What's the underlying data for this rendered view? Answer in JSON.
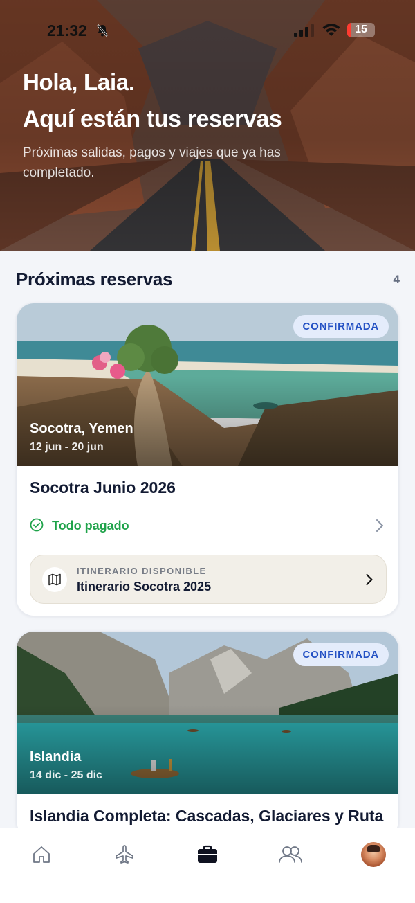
{
  "status_bar": {
    "time": "21:32",
    "battery_level": "15",
    "battery_fraction": 0.15,
    "icons": [
      "bell-slash-icon",
      "signal-icon",
      "wifi-icon",
      "battery-icon"
    ]
  },
  "hero": {
    "greeting": "Hola, Laia.",
    "title": "Aquí están tus reservas",
    "subtitle": "Próximas salidas, pagos y viajes que ya has completado."
  },
  "section": {
    "title": "Próximas reservas",
    "count": "4"
  },
  "bookings": [
    {
      "status": "CONFIRMADA",
      "location": "Socotra, Yemen",
      "dates": "12 jun - 20 jun",
      "title": "Socotra Junio 2026",
      "payment_status": "Todo pagado",
      "itinerary_label": "ITINERARIO DISPONIBLE",
      "itinerary_name": "Itinerario Socotra 2025"
    },
    {
      "status": "CONFIRMADA",
      "location": "Islandia",
      "dates": "14 dic - 25 dic",
      "title": "Islandia Completa: Cascadas, Glaciares y Ruta"
    }
  ],
  "tab_bar": {
    "tabs": [
      "home-icon",
      "plane-icon",
      "briefcase-icon",
      "users-icon",
      "avatar"
    ],
    "active": "briefcase-icon"
  },
  "colors": {
    "accent_blue": "#2451c4",
    "badge_bg": "#e4ecfb",
    "paid_green": "#1fa34a",
    "itinerary_bg": "#f2efe8",
    "page_bg": "#f3f5f9"
  }
}
